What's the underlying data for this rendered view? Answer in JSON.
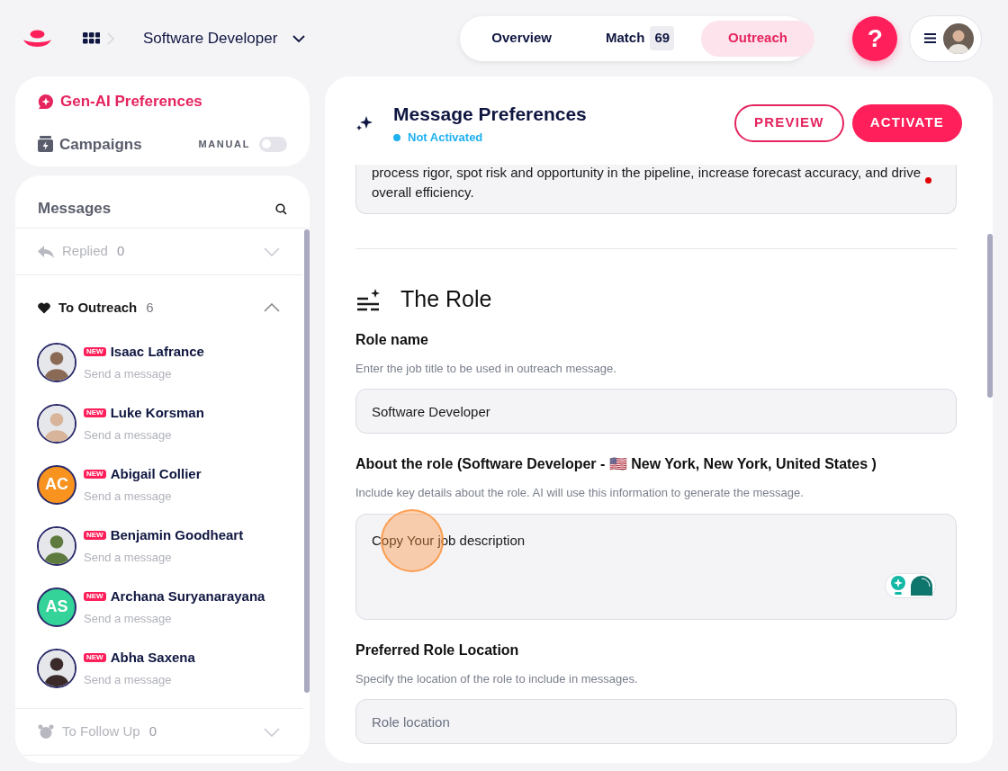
{
  "header": {
    "breadcrumb": "Software Developer",
    "tabs": [
      {
        "label": "Overview",
        "selected": false
      },
      {
        "label": "Match",
        "count": "69",
        "selected": false
      },
      {
        "label": "Outreach",
        "selected": true
      }
    ],
    "help": "?"
  },
  "sidebar": {
    "items": [
      {
        "label": "Gen-AI Preferences",
        "kind": "ai",
        "selected": true
      },
      {
        "label": "Campaigns",
        "kind": "campaigns",
        "selected": false,
        "toggle_label": "MANUAL",
        "on": false
      }
    ]
  },
  "messages": {
    "title": "Messages",
    "groups": [
      {
        "label": "Replied",
        "kind": "replied",
        "count": "0",
        "disabled": true,
        "expanded": false
      },
      {
        "label": "To Outreach",
        "kind": "heart",
        "count": "6",
        "disabled": false,
        "expanded": true,
        "contacts": [
          {
            "name": "Isaac Lafrance",
            "badge": "NEW",
            "subtitle": "Send a message",
            "kind": "photo",
            "color": "#8a6a55"
          },
          {
            "name": "Luke Korsman",
            "badge": "NEW",
            "subtitle": "Send a message",
            "kind": "photo",
            "color": "#d7b49a"
          },
          {
            "name": "Abigail Collier",
            "badge": "NEW",
            "subtitle": "Send a message",
            "kind": "initials",
            "initials": "AC",
            "color": "#f7931e"
          },
          {
            "name": "Benjamin Goodheart",
            "badge": "NEW",
            "subtitle": "Send a message",
            "kind": "photo",
            "color": "#5f7a3e"
          },
          {
            "name": "Archana Suryanarayana",
            "badge": "NEW",
            "subtitle": "Send a message",
            "kind": "initials",
            "initials": "AS",
            "color": "#34d399"
          },
          {
            "name": "Abha Saxena",
            "badge": "NEW",
            "subtitle": "Send a message",
            "kind": "photo",
            "color": "#3b2a2a"
          }
        ]
      },
      {
        "label": "To Follow Up",
        "kind": "alarm",
        "count": "0",
        "disabled": true,
        "expanded": false
      }
    ]
  },
  "panel": {
    "title": "Message Preferences",
    "status": "Not Activated",
    "buttons": [
      {
        "label": "PREVIEW",
        "kind": "outline"
      },
      {
        "label": "ACTIVATE",
        "kind": "filled"
      }
    ],
    "top_text": {
      "value": "process rigor, spot risk and opportunity in the pipeline, increase forecast accuracy, and drive overall efficiency.",
      "error_dot": true
    },
    "section_title": "The Role",
    "fields": [
      {
        "label": "Role name",
        "hint": "Enter the job title to be used in outreach message.",
        "kind": "input",
        "value": "Software Developer"
      },
      {
        "label": "About the role (Software Developer - 🇺🇸 New York, New York, United States )",
        "hint": "Include key details about the role. AI will use this information to generate the message.",
        "kind": "textarea",
        "value": "Copy Your job description",
        "click_highlight": true
      },
      {
        "label": "Preferred Role Location",
        "hint": "Specify the location of the role to include in messages.",
        "kind": "input",
        "placeholder": "Role location"
      }
    ]
  }
}
